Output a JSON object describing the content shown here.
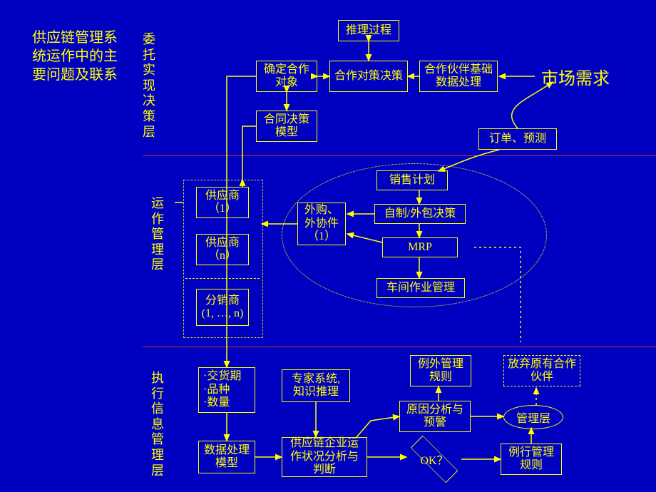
{
  "title": "供应链管理系统运作中的主要问题及联系",
  "market_demand": "市场需求",
  "layers": {
    "entrust_decision": "委托实现决策层",
    "operation_mgmt": "运作管理层",
    "exec_info_mgmt": "执行信息管理层"
  },
  "top": {
    "inference_process": "推理过程",
    "determine_partner": "确定合作对象",
    "coop_strategy_decision": "合作对策决策",
    "partner_base_data": "合作伙伴基础数据处理",
    "contract_decision_model": "合同决策模型",
    "order_forecast": "订单、预测"
  },
  "mid": {
    "supplier1": "供应商（1）",
    "suppliern": "供应商（n）",
    "distributor": "分销商\n(1, …, n)",
    "sales_plan": "销售计划",
    "make_outsource": "自制/外包决策",
    "purchase_parts": "外购、外协件（1）",
    "mrp": "MRP",
    "shopfloor": "车间作业管理"
  },
  "bottom": {
    "delivery_items": "·交货期\n·品种\n·数量",
    "expert_system": "专家系统,\n知识推理",
    "data_model": "数据处理模型",
    "scm_analysis": "供应链企业运作状况分析与判断",
    "exception_rule": "例外管理规则",
    "cause_warning": "原因分析与预警",
    "ok": "OK？",
    "management": "管理层",
    "routine_rule": "例行管理规则",
    "abandon_partner": "放弃原有合作伙伴"
  }
}
